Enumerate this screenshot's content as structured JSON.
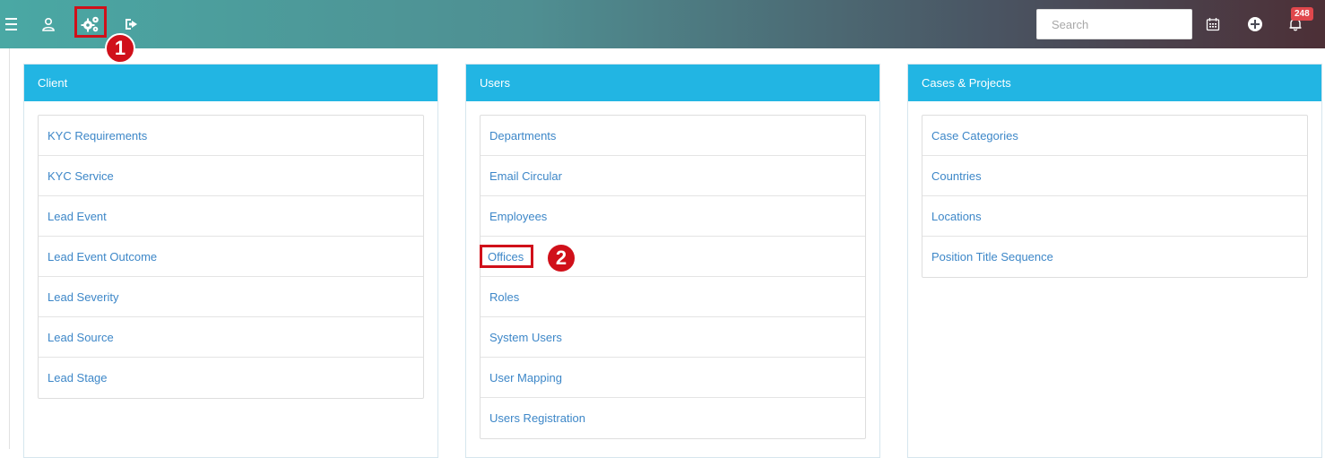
{
  "header": {
    "search_placeholder": "Search",
    "notification_count": "248",
    "icons": [
      "menu-icon",
      "user-icon",
      "settings-gears-icon",
      "logout-icon",
      "calendar-icon",
      "add-circle-icon",
      "bell-icon"
    ]
  },
  "annotations": {
    "marker1": "1",
    "marker2": "2"
  },
  "panels": [
    {
      "title": "Client",
      "items": [
        "KYC Requirements",
        "KYC Service",
        "Lead Event",
        "Lead Event Outcome",
        "Lead Severity",
        "Lead Source",
        "Lead Stage"
      ]
    },
    {
      "title": "Users",
      "items": [
        "Departments",
        "Email Circular",
        "Employees",
        "Offices",
        "Roles",
        "System Users",
        "User Mapping",
        "Users Registration"
      ]
    },
    {
      "title": "Cases & Projects",
      "items": [
        "Case Categories",
        "Countries",
        "Locations",
        "Position Title Sequence"
      ]
    }
  ],
  "colors": {
    "panel_header": "#22b5e3",
    "link": "#3d87c8",
    "highlight": "#d0101a",
    "badge": "#e0474c"
  }
}
